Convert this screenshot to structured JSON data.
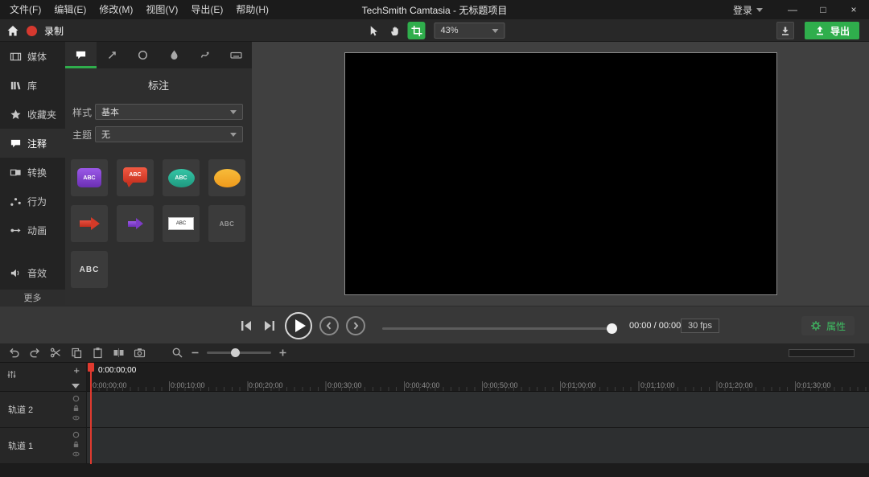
{
  "window": {
    "menu_items": [
      "文件(F)",
      "编辑(E)",
      "修改(M)",
      "视图(V)",
      "导出(E)",
      "帮助(H)"
    ],
    "title": "TechSmith Camtasia - 无标题项目",
    "login_label": "登录",
    "controls": {
      "minimize": "—",
      "maximize": "□",
      "close": "×"
    }
  },
  "toolbar": {
    "record_label": "录制",
    "zoom_value": "43%",
    "export_label": "导出"
  },
  "sidebar": {
    "items": [
      {
        "label": "媒体"
      },
      {
        "label": "库"
      },
      {
        "label": "收藏夹"
      },
      {
        "label": "注释"
      },
      {
        "label": "转换"
      },
      {
        "label": "行为"
      },
      {
        "label": "动画"
      },
      {
        "label": "音效"
      }
    ],
    "more_label": "更多"
  },
  "panel": {
    "title": "标注",
    "style_label": "样式",
    "style_value": "基本",
    "theme_label": "主题",
    "theme_value": "无",
    "callout_text": "ABC"
  },
  "playback": {
    "time_display": "00:00 / 00:00",
    "fps_label": "30 fps",
    "properties_label": "属性"
  },
  "timeline": {
    "playhead_time": "0:00:00;00",
    "ruler_ticks": [
      "0:00:00;00",
      "0:00:10;00",
      "0:00:20;00",
      "0:00:30;00",
      "0:00:40;00",
      "0:00:50;00",
      "0:01:00;00",
      "0:01:10;00",
      "0:01:20;00",
      "0:01:30;00"
    ],
    "tracks": [
      {
        "name": "轨道 2"
      },
      {
        "name": "轨道 1"
      }
    ]
  },
  "colors": {
    "accent_green": "#2fae4c",
    "record_red": "#d6392f",
    "playhead_red": "#e03a2f",
    "callout_purple": "#7b3fc4",
    "callout_red": "#d8402c",
    "callout_teal": "#28b79a",
    "callout_orange": "#f2a93b"
  }
}
